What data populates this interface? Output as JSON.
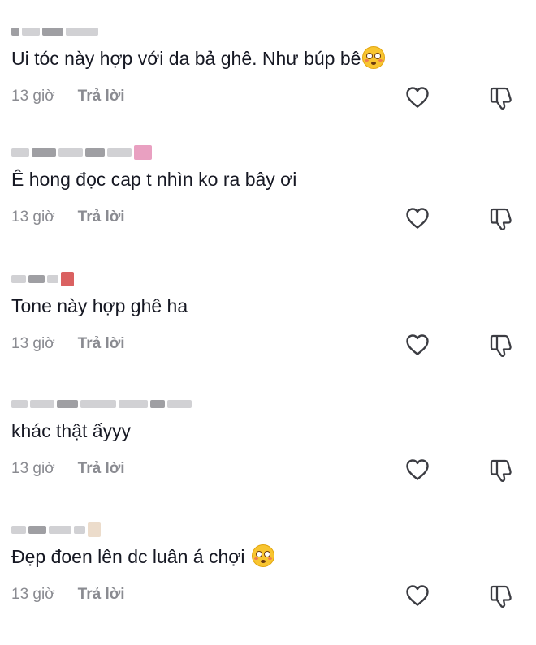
{
  "comments": [
    {
      "text": "Ui tóc này hợp với da bả ghê. Như búp bê",
      "has_emoji": true,
      "emoji_name": "flushed-face-emoji",
      "time": "13 giờ",
      "reply_label": "Trả lời"
    },
    {
      "text": "Ê hong đọc cap t nhìn ko ra bây ơi",
      "has_emoji": false,
      "time": "13 giờ",
      "reply_label": "Trả lời"
    },
    {
      "text": "Tone này hợp ghê ha",
      "has_emoji": false,
      "time": "13 giờ",
      "reply_label": "Trả lời"
    },
    {
      "text": "khác thật ấyyy",
      "has_emoji": false,
      "time": "13 giờ",
      "reply_label": "Trả lời"
    },
    {
      "text": "Đẹp đoen lên dc luân á chợi ",
      "has_emoji": true,
      "emoji_name": "flushed-face-emoji",
      "time": "13 giờ",
      "reply_label": "Trả lời"
    }
  ],
  "icons": {
    "like": "heart-outline-icon",
    "dislike": "thumbs-down-icon"
  },
  "colors": {
    "text": "#161823",
    "meta": "#8a8b91",
    "icon": "#3b3c42",
    "username_blur": "#c9c9cc"
  }
}
